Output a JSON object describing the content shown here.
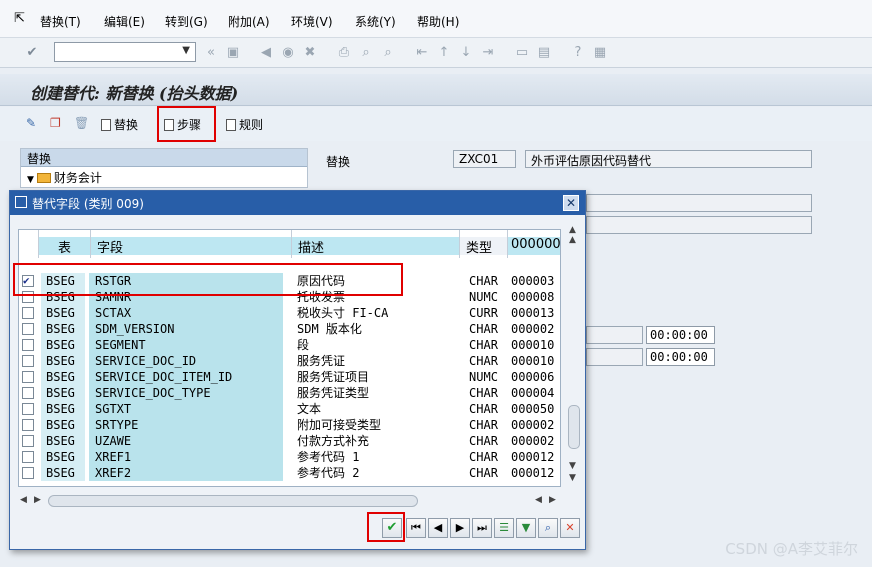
{
  "menu": [
    "替换(T)",
    "编辑(E)",
    "转到(G)",
    "附加(A)",
    "环境(V)",
    "系统(Y)",
    "帮助(H)"
  ],
  "screen_title": "创建替代: 新替换 (抬头数据)",
  "app_toolbar": {
    "substitution": "替换",
    "steps": "步骤",
    "rules": "规则"
  },
  "tree": {
    "header": "替换",
    "node": "财务会计"
  },
  "form": {
    "label_substitution": "替换",
    "code": "ZXC01",
    "description": "外币评估原因代码替代",
    "time1": "00:00:00",
    "time2": "00:00:00"
  },
  "dialog": {
    "title": "替代字段 (类别 009)",
    "columns": {
      "table": "表",
      "field": "字段",
      "desc": "描述",
      "type": "类型",
      "len": "000000"
    },
    "rows": [
      {
        "checked": true,
        "table": "BSEG",
        "field": "RSTGR",
        "desc": "原因代码",
        "type": "CHAR",
        "len": "000003"
      },
      {
        "checked": false,
        "table": "BSEG",
        "field": "SAMNR",
        "desc": "托收发票",
        "type": "NUMC",
        "len": "000008"
      },
      {
        "checked": false,
        "table": "BSEG",
        "field": "SCTAX",
        "desc": "税收头寸 FI-CA",
        "type": "CURR",
        "len": "000013"
      },
      {
        "checked": false,
        "table": "BSEG",
        "field": "SDM_VERSION",
        "desc": "SDM 版本化",
        "type": "CHAR",
        "len": "000002"
      },
      {
        "checked": false,
        "table": "BSEG",
        "field": "SEGMENT",
        "desc": "段",
        "type": "CHAR",
        "len": "000010"
      },
      {
        "checked": false,
        "table": "BSEG",
        "field": "SERVICE_DOC_ID",
        "desc": "服务凭证",
        "type": "CHAR",
        "len": "000010"
      },
      {
        "checked": false,
        "table": "BSEG",
        "field": "SERVICE_DOC_ITEM_ID",
        "desc": "服务凭证项目",
        "type": "NUMC",
        "len": "000006"
      },
      {
        "checked": false,
        "table": "BSEG",
        "field": "SERVICE_DOC_TYPE",
        "desc": "服务凭证类型",
        "type": "CHAR",
        "len": "000004"
      },
      {
        "checked": false,
        "table": "BSEG",
        "field": "SGTXT",
        "desc": "文本",
        "type": "CHAR",
        "len": "000050"
      },
      {
        "checked": false,
        "table": "BSEG",
        "field": "SRTYPE",
        "desc": "附加可接受类型",
        "type": "CHAR",
        "len": "000002"
      },
      {
        "checked": false,
        "table": "BSEG",
        "field": "UZAWE",
        "desc": "付款方式补充",
        "type": "CHAR",
        "len": "000002"
      },
      {
        "checked": false,
        "table": "BSEG",
        "field": "XREF1",
        "desc": "参考代码 1",
        "type": "CHAR",
        "len": "000012"
      },
      {
        "checked": false,
        "table": "BSEG",
        "field": "XREF2",
        "desc": "参考代码 2",
        "type": "CHAR",
        "len": "000012"
      }
    ]
  },
  "watermark": "CSDN @A李艾菲尔"
}
